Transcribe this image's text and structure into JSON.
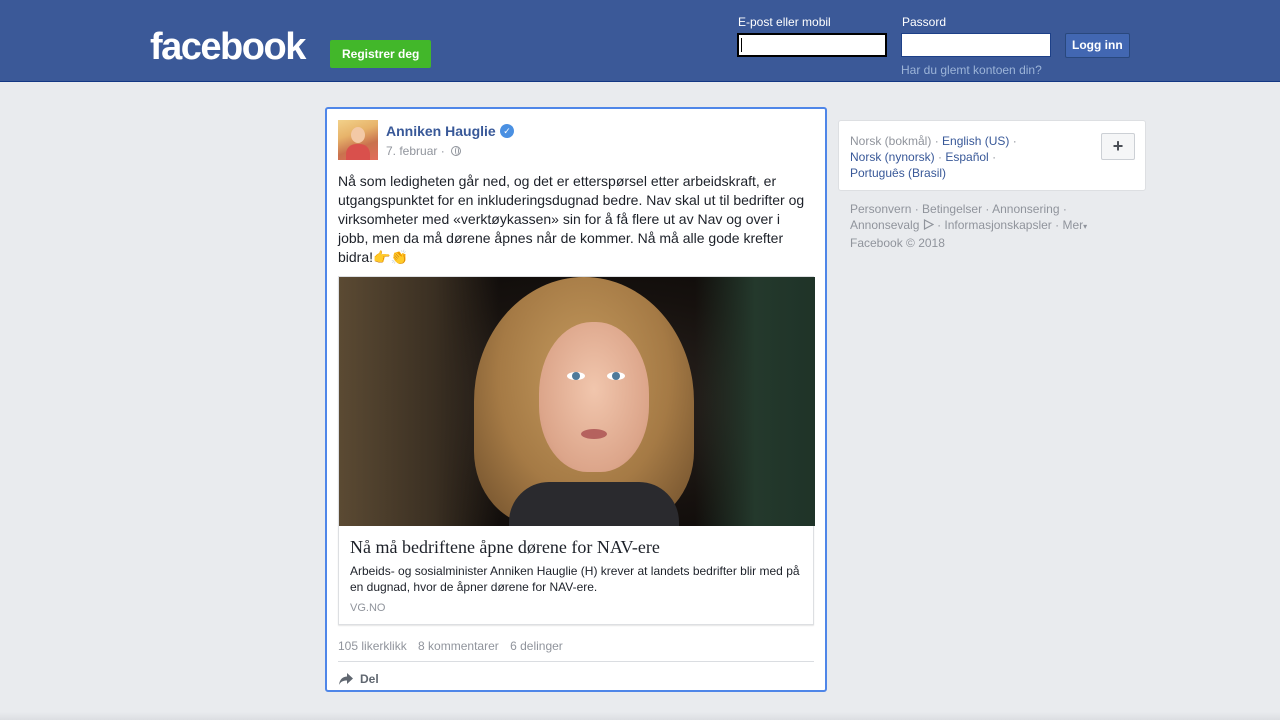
{
  "header": {
    "logo": "facebook",
    "register_label": "Registrer deg",
    "email_label": "E-post eller mobil",
    "email_value": "",
    "password_label": "Passord",
    "password_value": "",
    "login_label": "Logg inn",
    "forgot_label": "Har du glemt kontoen din?"
  },
  "post": {
    "author": "Anniken Hauglie",
    "verified_icon": "verified-badge-icon",
    "date": "7. februar · ",
    "privacy_icon": "globe-icon",
    "text": "Nå som ledigheten går ned, og det er etterspørsel etter arbeidskraft, er utgangspunktet for en inkluderingsdugnad bedre. Nav skal ut til bedrifter og virksomheter med «verktøykassen» sin for å få flere ut av Nav og over i jobb, men da må dørene åpnes når de kommer. Nå må alle gode krefter bidra!👉👏",
    "link": {
      "title": "Nå må bedriftene åpne dørene for NAV-ere",
      "description": "Arbeids- og sosialminister Anniken Hauglie (H) krever at landets bedrifter blir med på en dugnad, hvor de åpner dørene for NAV-ere.",
      "domain": "VG.NO"
    },
    "likes": "105 likerklikk",
    "comments": "8 kommentarer",
    "shares": "6 delinger",
    "share_label": "Del"
  },
  "sidebar": {
    "languages": {
      "current": "Norsk (bokmål)",
      "english": "English (US)",
      "nynorsk": "Norsk (nynorsk)",
      "spanish": "Español",
      "portuguese": "Português (Brasil)",
      "sep": " · "
    },
    "add_label": "+",
    "footer": {
      "privacy": "Personvern",
      "terms": "Betingelser",
      "ads": "Annonsering",
      "adchoices": "Annonsevalg",
      "cookies": "Informasjonskapsler",
      "more": "Mer",
      "copyright": "Facebook © 2018"
    }
  },
  "colors": {
    "brand": "#3b5998",
    "register_green": "#42b72a",
    "link_blue": "#385898",
    "focus_border": "#4f86e8"
  }
}
